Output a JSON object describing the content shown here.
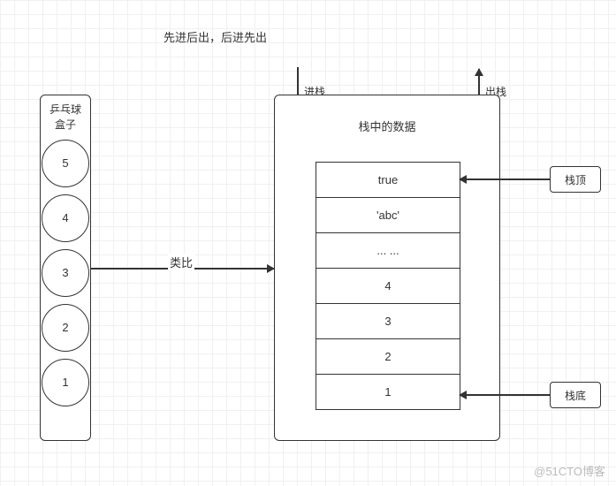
{
  "title": "先进后出，后进先出",
  "ballBox": {
    "label1": "乒乓球",
    "label2": "盒子",
    "balls": [
      "5",
      "4",
      "3",
      "2",
      "1"
    ]
  },
  "analogyLabel": "类比",
  "stack": {
    "title": "栈中的数据",
    "pushLabel": "进栈",
    "popLabel": "出栈",
    "cells": [
      "true",
      "'abc'",
      "... ...",
      "4",
      "3",
      "2",
      "1"
    ]
  },
  "pointers": {
    "top": "栈顶",
    "bottom": "栈底"
  },
  "watermark": "@51CTO博客"
}
